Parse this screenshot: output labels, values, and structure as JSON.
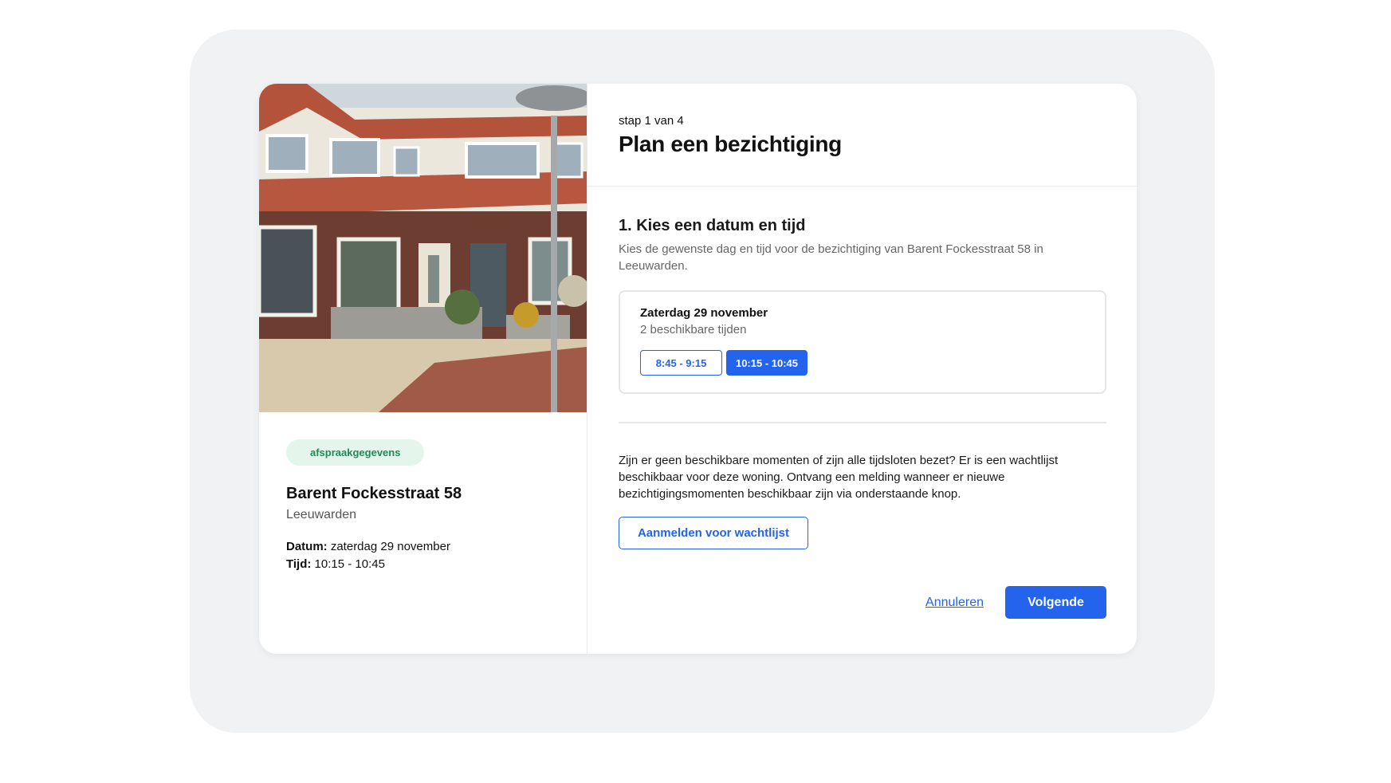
{
  "property": {
    "badge": "afspraakgegevens",
    "address": "Barent Fockesstraat 58",
    "city": "Leeuwarden",
    "date_label": "Datum:",
    "date_value": " zaterdag 29 november",
    "time_label": "Tijd:",
    "time_value": " 10:15 - 10:45",
    "photo_icon": "house-photo"
  },
  "header": {
    "step": "stap 1 van 4",
    "title": "Plan een bezichtiging"
  },
  "section": {
    "title": "1. Kies een datum en tijd",
    "description": "Kies de gewenste dag en tijd voor de bezichtiging van Barent Fockesstraat 58 in Leeuwarden."
  },
  "day": {
    "title": "Zaterdag 29 november",
    "subtitle": "2 beschikbare tijden",
    "slots": [
      "8:45 - 9:15",
      "10:15 - 10:45"
    ],
    "selected_index": 1
  },
  "waitlist": {
    "text": "Zijn er geen beschikbare momenten of zijn alle tijdsloten bezet? Er is een wachtlijst beschikbaar voor deze woning. Ontvang een melding wanneer er nieuwe bezichtigingsmomenten beschikbaar zijn via onderstaande knop.",
    "button": "Aanmelden voor wachtlijst"
  },
  "actions": {
    "cancel": "Annuleren",
    "next": "Volgende"
  },
  "colors": {
    "primary": "#2463eb",
    "badge_bg": "#e4f6ec",
    "badge_text": "#1f8a55"
  }
}
